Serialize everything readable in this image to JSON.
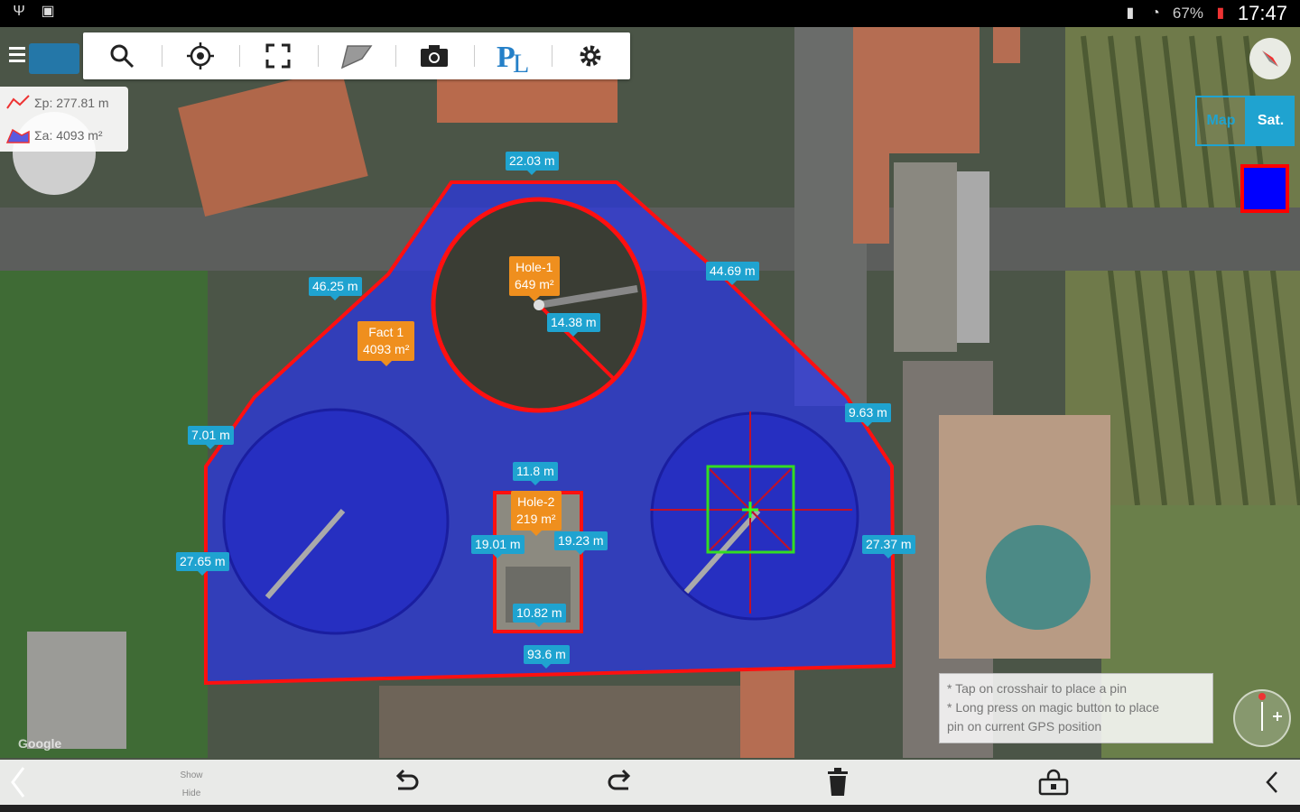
{
  "status_bar": {
    "battery": "67%",
    "time": "17:47"
  },
  "toolbar": {
    "icons": [
      "search-icon",
      "locate-icon",
      "fullscreen-icon",
      "polygon-icon",
      "camera-icon",
      "pl-logo",
      "gear-icon"
    ]
  },
  "stats": {
    "perimeter": "Σp: 277.81 m",
    "area": "Σa: 4093 m²"
  },
  "measurements": {
    "m1": "22.03 m",
    "m2": "46.25 m",
    "m3": "44.69 m",
    "m4": "14.38 m",
    "m5": "9.63 m",
    "m6": "7.01 m",
    "m7": "11.8 m",
    "m8": "19.01 m",
    "m9": "19.23 m",
    "m10": "27.65 m",
    "m11": "27.37 m",
    "m12": "10.82 m",
    "m13": "93.6 m"
  },
  "tags": {
    "hole1_name": "Hole-1",
    "hole1_area": "649 m²",
    "fact1_name": "Fact 1",
    "fact1_area": "4093 m²",
    "hole2_name": "Hole-2",
    "hole2_area": "219 m²"
  },
  "map_type": {
    "map": "Map",
    "sat": "Sat."
  },
  "fill_color": "#0000ff",
  "hint": {
    "line1": "* Tap on crosshair to place a pin",
    "line2": "* Long press on magic button to place",
    "line3": "pin on current GPS position"
  },
  "bottom": {
    "show_label": "Show",
    "hide_label": "Hide"
  },
  "attribution": "Google"
}
